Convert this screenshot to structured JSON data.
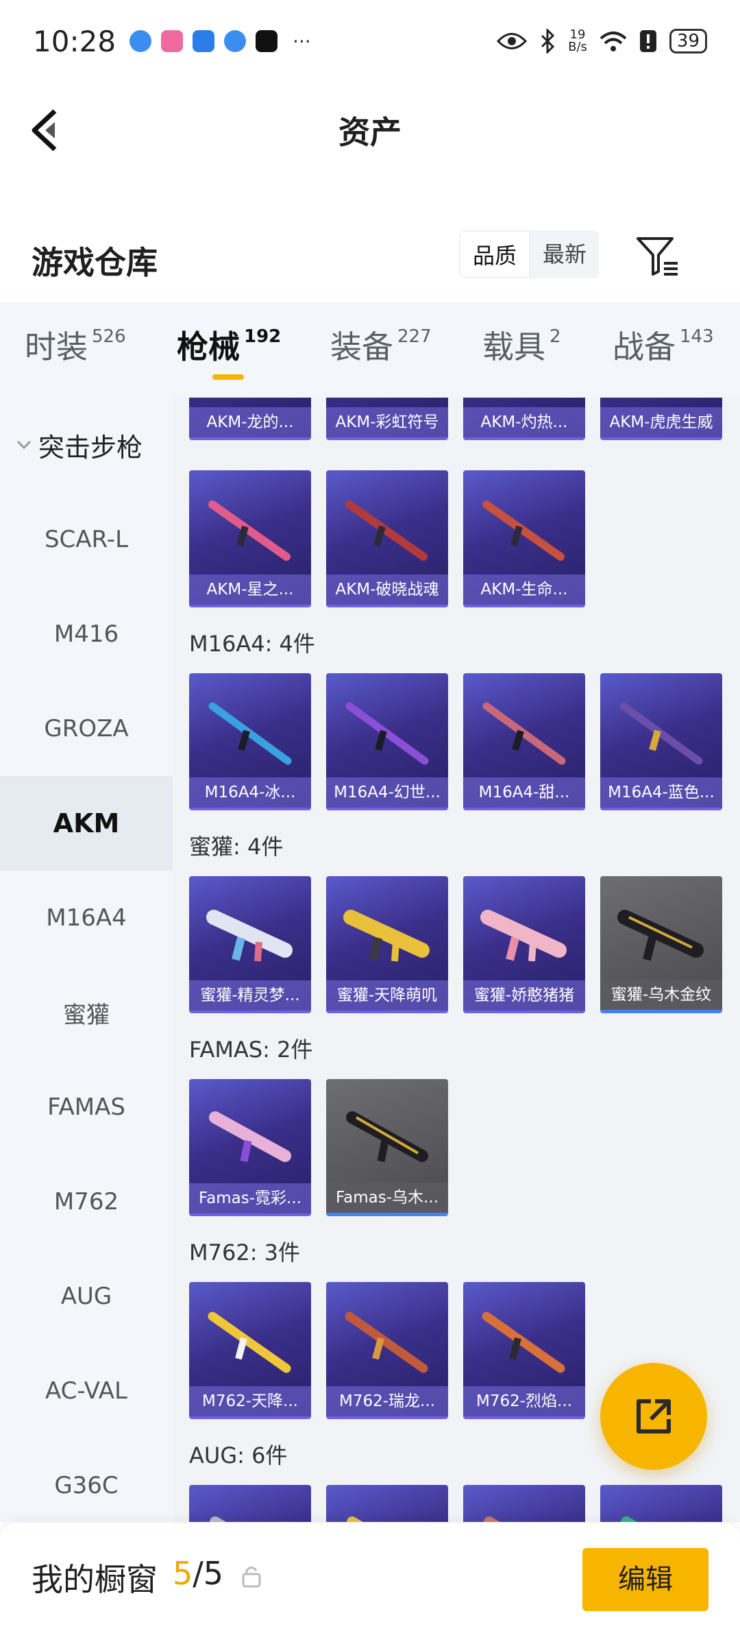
{
  "status_bar": {
    "time": "10:28",
    "net_speed_value": "19",
    "net_speed_unit": "B/s",
    "battery": "39"
  },
  "header": {
    "title": "资产"
  },
  "warehouse": {
    "title": "游戏仓库",
    "sort_options": [
      {
        "label": "品质",
        "active": true
      },
      {
        "label": "最新",
        "active": false
      }
    ]
  },
  "tabs": [
    {
      "label": "时装",
      "count": "526",
      "active": false
    },
    {
      "label": "枪械",
      "count": "192",
      "active": true
    },
    {
      "label": "装备",
      "count": "227",
      "active": false
    },
    {
      "label": "载具",
      "count": "2",
      "active": false
    },
    {
      "label": "战备",
      "count": "143",
      "active": false
    }
  ],
  "sidebar": {
    "group": "突击步枪",
    "items": [
      {
        "label": "SCAR-L"
      },
      {
        "label": "M416"
      },
      {
        "label": "GROZA"
      },
      {
        "label": "AKM",
        "active": true
      },
      {
        "label": "M16A4"
      },
      {
        "label": "蜜獾"
      },
      {
        "label": "FAMAS"
      },
      {
        "label": "M762"
      },
      {
        "label": "AUG"
      },
      {
        "label": "AC-VAL"
      },
      {
        "label": "G36C"
      }
    ]
  },
  "content": {
    "akm_partial": [
      "AKM-龙的...",
      "AKM-彩虹符号",
      "AKM-灼热...",
      "AKM-虎虎生威"
    ],
    "akm_more": [
      "AKM-星之...",
      "AKM-破晓战魂",
      "AKM-生命..."
    ],
    "sections": [
      {
        "label": "M16A4: 4件",
        "items": [
          "M16A4-冰...",
          "M16A4-幻世...",
          "M16A4-甜...",
          "M16A4-蓝色..."
        ]
      },
      {
        "label": "蜜獾: 4件",
        "items": [
          "蜜獾-精灵梦...",
          "蜜獾-天降萌叽",
          "蜜獾-娇憨猪猪",
          "蜜獾-乌木金纹"
        ]
      },
      {
        "label": "FAMAS: 2件",
        "items": [
          "Famas-霓彩...",
          "Famas-乌木..."
        ]
      },
      {
        "label": "M762: 3件",
        "items": [
          "M762-天降...",
          "M762-瑞龙...",
          "M762-烈焰..."
        ]
      },
      {
        "label": "AUG: 6件",
        "items": []
      }
    ]
  },
  "bottom_bar": {
    "title": "我的橱窗",
    "count_current": "5",
    "count_total": "/5",
    "edit_label": "编辑"
  },
  "colors": {
    "accent": "#f8b500",
    "card_purple": "#3b2f8a",
    "card_gray": "#4a4a4e"
  }
}
